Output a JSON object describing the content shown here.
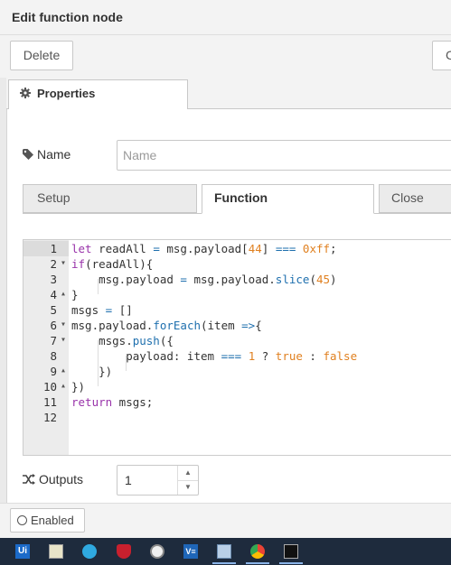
{
  "dialog": {
    "title": "Edit function node",
    "delete_label": "Delete",
    "right_button_partial": "C"
  },
  "tabs": {
    "properties_label": "Properties"
  },
  "name_field": {
    "label": "Name",
    "placeholder": "Name",
    "value": ""
  },
  "subtabs": {
    "setup": "Setup",
    "function": "Function",
    "close": "Close"
  },
  "editor": {
    "lines": [
      {
        "num": "1",
        "fold": ""
      },
      {
        "num": "2",
        "fold": "▾"
      },
      {
        "num": "3",
        "fold": ""
      },
      {
        "num": "4",
        "fold": "▴"
      },
      {
        "num": "5",
        "fold": ""
      },
      {
        "num": "6",
        "fold": "▾"
      },
      {
        "num": "7",
        "fold": "▾"
      },
      {
        "num": "8",
        "fold": ""
      },
      {
        "num": "9",
        "fold": "▴"
      },
      {
        "num": "10",
        "fold": "▴"
      },
      {
        "num": "11",
        "fold": ""
      },
      {
        "num": "12",
        "fold": ""
      }
    ],
    "code": {
      "l1_let": "let",
      "l1_a": " readAll ",
      "l1_eq": "=",
      "l1_b": " msg.payload[",
      "l1_44": "44",
      "l1_c": "] ",
      "l1_op": "===",
      "l1_d": " ",
      "l1_hex": "0xff",
      "l1_e": ";",
      "l2_if": "if",
      "l2_a": "(readAll){",
      "l3_a": "    msg.payload ",
      "l3_eq": "=",
      "l3_b": " msg.payload.",
      "l3_slice": "slice",
      "l3_c": "(",
      "l3_45": "45",
      "l3_d": ")",
      "l4": "}",
      "l5_a": "msgs ",
      "l5_eq": "=",
      "l5_b": " []",
      "l6_a": "msg.payload.",
      "l6_fe": "forEach",
      "l6_b": "(item ",
      "l6_ar": "=>",
      "l6_c": "{",
      "l7_a": "    msgs.",
      "l7_push": "push",
      "l7_b": "({",
      "l8_a": "        payload: item ",
      "l8_op": "===",
      "l8_b": " ",
      "l8_1": "1",
      "l8_c": " ? ",
      "l8_true": "true",
      "l8_d": " : ",
      "l8_false": "false",
      "l9": "    })",
      "l10": "})",
      "l11_ret": "return",
      "l11_a": " msgs;"
    }
  },
  "outputs": {
    "label": "Outputs",
    "value": "1"
  },
  "footer": {
    "enabled_label": "Enabled"
  },
  "taskbar": {
    "ui_icon_label": "Ui",
    "vs_icon_label": "V≡"
  },
  "colors": {
    "keyword": "#9933aa",
    "number": "#e08020",
    "function": "#1e6fae",
    "taskbar": "#1e2b3d"
  }
}
